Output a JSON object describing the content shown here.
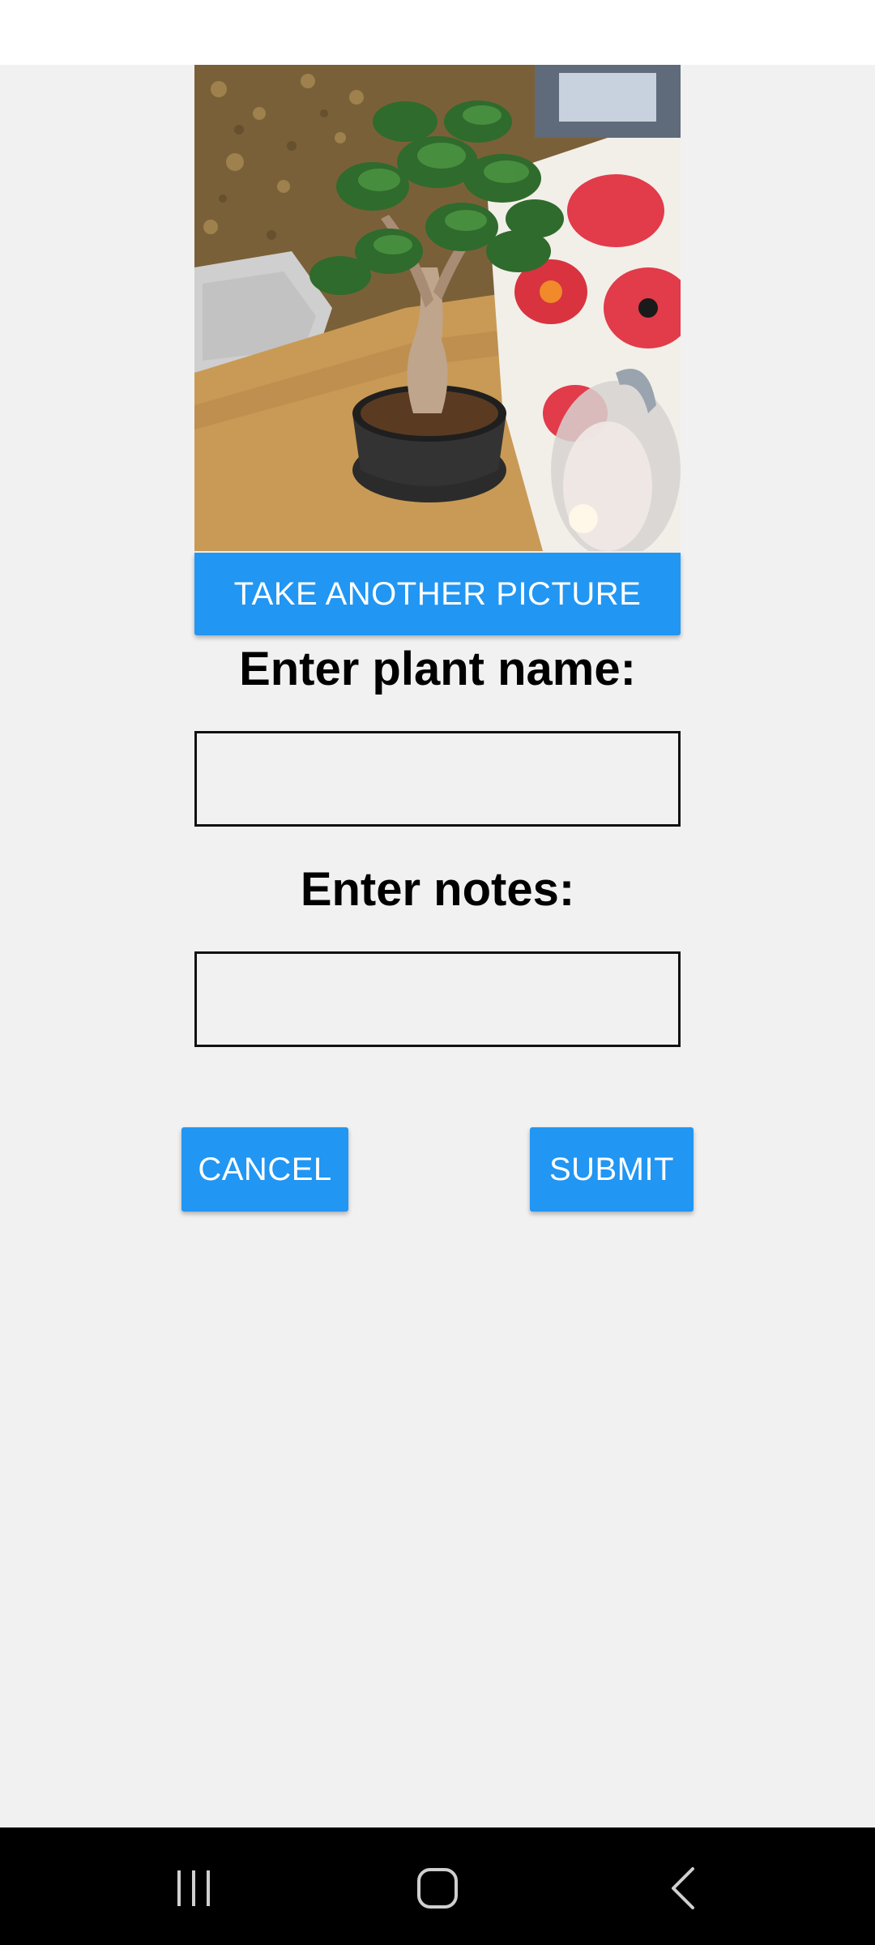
{
  "photo": {
    "alt": "plant photo",
    "icon": "photo-image"
  },
  "actions": {
    "take_picture_label": "TAKE ANOTHER PICTURE",
    "cancel_label": "CANCEL",
    "submit_label": "SUBMIT"
  },
  "form": {
    "plant_name_label": "Enter plant name:",
    "plant_name_value": "",
    "notes_label": "Enter notes:",
    "notes_value": ""
  },
  "nav": {
    "recent_icon": "recent-apps-icon",
    "home_icon": "home-icon",
    "back_icon": "back-icon"
  },
  "colors": {
    "accent": "#2196f3",
    "background": "#f1f1f1",
    "nav_bar": "#000000"
  }
}
